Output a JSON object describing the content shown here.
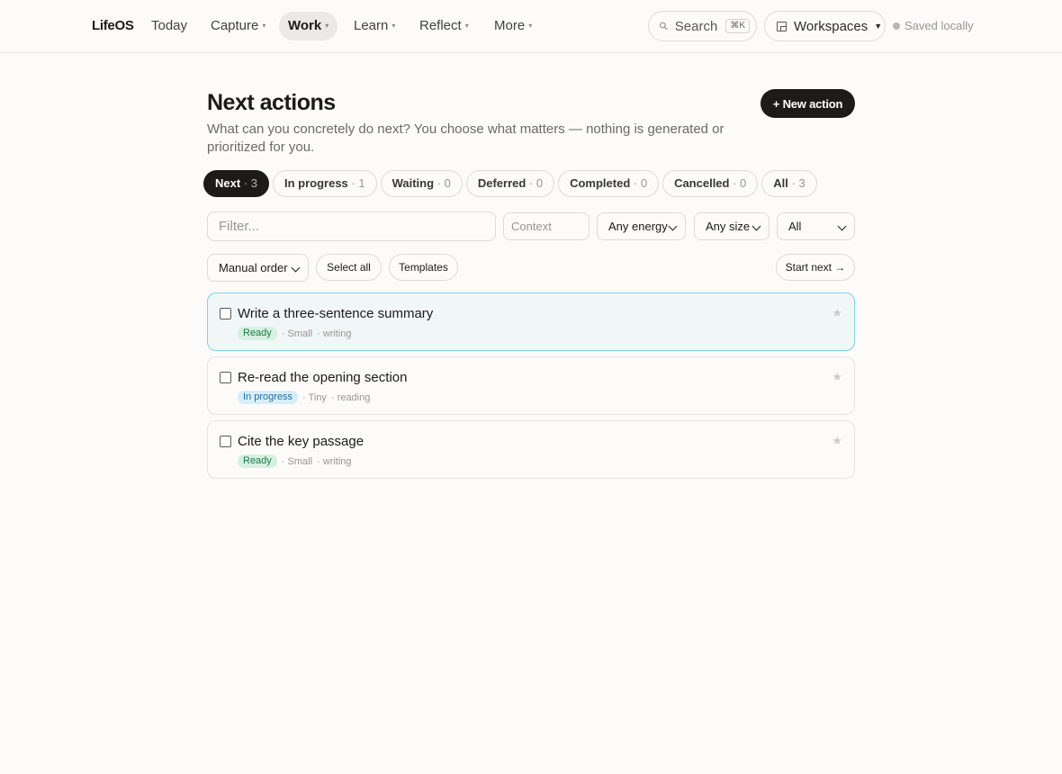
{
  "nav": {
    "brand": "LifeOS",
    "items": [
      {
        "label": "Today",
        "caret": ""
      },
      {
        "label": "Capture",
        "caret": "▾"
      },
      {
        "label": "Work",
        "caret": "▾"
      },
      {
        "label": "Learn",
        "caret": "▾"
      },
      {
        "label": "Reflect",
        "caret": "▾"
      },
      {
        "label": "More",
        "caret": "▾"
      }
    ],
    "active": "Work",
    "search_label": "Search",
    "search_shortcut": "⌘K",
    "workspaces_label": "Workspaces",
    "saved_status": "Saved locally"
  },
  "header": {
    "title": "Next actions",
    "subtitle": "What can you concretely do next? You choose what matters — nothing is generated or prioritized for you.",
    "new_button": "+ New action"
  },
  "tabs": [
    {
      "label": "Next",
      "count": "· 3"
    },
    {
      "label": "In progress",
      "count": "· 1"
    },
    {
      "label": "Waiting",
      "count": "· 0"
    },
    {
      "label": "Deferred",
      "count": "· 0"
    },
    {
      "label": "Completed",
      "count": "· 0"
    },
    {
      "label": "Cancelled",
      "count": "· 0"
    },
    {
      "label": "All",
      "count": "· 3"
    }
  ],
  "filters": {
    "filter_placeholder": "Filter...",
    "context_placeholder": "Context",
    "energy": "Any energy",
    "size": "Any size",
    "scope": "All",
    "order": "Manual order",
    "select_all": "Select all",
    "templates": "Templates",
    "start_next": "Start next →"
  },
  "actions": [
    {
      "title": "Write a three-sentence summary",
      "status": "Ready",
      "size": "· Small",
      "context": "· writing"
    },
    {
      "title": "Re-read the opening section",
      "status": "In progress",
      "size": "· Tiny",
      "context": "· reading"
    },
    {
      "title": "Cite the key passage",
      "status": "Ready",
      "size": "· Small",
      "context": "· writing"
    }
  ],
  "colors": {
    "background": "#fcfbf9",
    "primary": "#1c1b1a",
    "selected_border": "#7dd3e8",
    "ready_badge": "#d6f0e1",
    "progress_badge": "#d7eefa"
  }
}
